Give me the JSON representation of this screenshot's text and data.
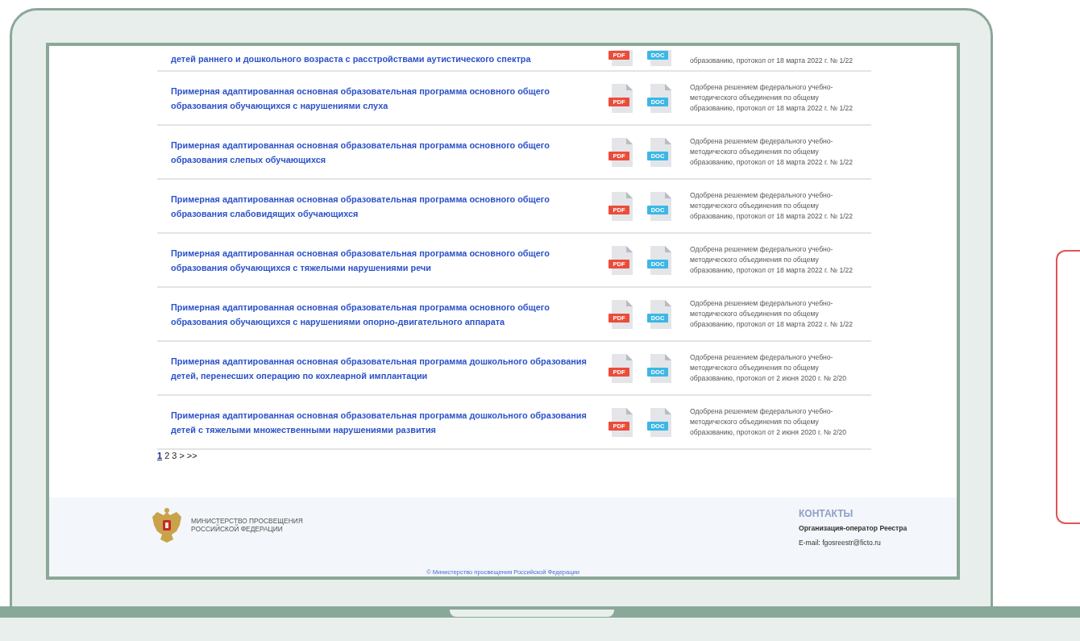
{
  "documents": [
    {
      "title": "детей раннего и дошкольного возраста с расстройствами аутистического спектра",
      "files": [
        {
          "kind": "pdf",
          "label": "PDF"
        },
        {
          "kind": "doc",
          "label": "DOC"
        }
      ],
      "approval": "образованию, протокол от 18 марта 2022 г. № 1/22"
    },
    {
      "title": "Примерная адаптированная основная образовательная программа основного общего\nобразования обучающихся с нарушениями слуха",
      "files": [
        {
          "kind": "pdf",
          "label": "PDF"
        },
        {
          "kind": "doc",
          "label": "DOC"
        }
      ],
      "approval": "Одобрена решением федерального учебно-\nметодического объединения по общему\nобразованию, протокол от 18 марта 2022 г. № 1/22"
    },
    {
      "title": "Примерная адаптированная основная образовательная программа основного общего\nобразования слепых обучающихся",
      "files": [
        {
          "kind": "pdf",
          "label": "PDF"
        },
        {
          "kind": "doc",
          "label": "DOC"
        }
      ],
      "approval": "Одобрена решением федерального учебно-\nметодического объединения по общему\nобразованию, протокол от 18 марта 2022 г. № 1/22"
    },
    {
      "title": "Примерная адаптированная основная образовательная программа основного общего\nобразования слабовидящих обучающихся",
      "files": [
        {
          "kind": "pdf",
          "label": "PDF"
        },
        {
          "kind": "doc",
          "label": "DOC"
        }
      ],
      "approval": "Одобрена решением федерального учебно-\nметодического объединения по общему\nобразованию, протокол от 18 марта 2022 г. № 1/22"
    },
    {
      "title": "Примерная адаптированная основная образовательная программа основного общего\nобразования обучающихся с тяжелыми нарушениями речи",
      "files": [
        {
          "kind": "pdf",
          "label": "PDF"
        },
        {
          "kind": "doc",
          "label": "DOC"
        }
      ],
      "approval": "Одобрена решением федерального учебно-\nметодического объединения по общему\nобразованию, протокол от 18 марта 2022 г. № 1/22"
    },
    {
      "title": "Примерная адаптированная основная образовательная программа основного общего\nобразования обучающихся с нарушениями опорно-двигательного аппарата",
      "files": [
        {
          "kind": "pdf",
          "label": "PDF"
        },
        {
          "kind": "doc",
          "label": "DOC"
        }
      ],
      "approval": "Одобрена решением федерального учебно-\nметодического объединения по общему\nобразованию, протокол от 18 марта 2022 г. № 1/22"
    },
    {
      "title": "Примерная адаптированная основная образовательная программа дошкольного образования\nдетей, перенесших операцию по кохлеарной имплантации",
      "files": [
        {
          "kind": "pdf",
          "label": "PDF"
        },
        {
          "kind": "doc",
          "label": "DOC"
        }
      ],
      "approval": "Одобрена решением федерального учебно-\nметодического объединения по общему\nобразованию, протокол от 2 июня 2020 г. № 2/20"
    },
    {
      "title": "Примерная адаптированная основная образовательная программа дошкольного образования\nдетей с тяжелыми множественными нарушениями развития",
      "files": [
        {
          "kind": "pdf",
          "label": "PDF"
        },
        {
          "kind": "doc",
          "label": "DOC"
        }
      ],
      "approval": "Одобрена решением федерального учебно-\nметодического объединения по общему\nобразованию, протокол от 2 июня 2020 г. № 2/20"
    }
  ],
  "pagination": [
    {
      "label": "1",
      "selected": true
    },
    {
      "label": "2",
      "selected": false
    },
    {
      "label": "3",
      "selected": false
    },
    {
      "label": ">",
      "selected": false
    },
    {
      "label": ">>",
      "selected": false
    }
  ],
  "footer": {
    "ministry": "МИНИСТЕРСТВО ПРОСВЕЩЕНИЯ\nРОССИЙСКОЙ ФЕДЕРАЦИИ",
    "contacts_heading": "КОНТАКТЫ",
    "organization": "Организация-оператор Реестра",
    "email": "E-mail: fgosreestr@ficto.ru",
    "copyright": "© Министерство просвещения Российской Федерации"
  }
}
